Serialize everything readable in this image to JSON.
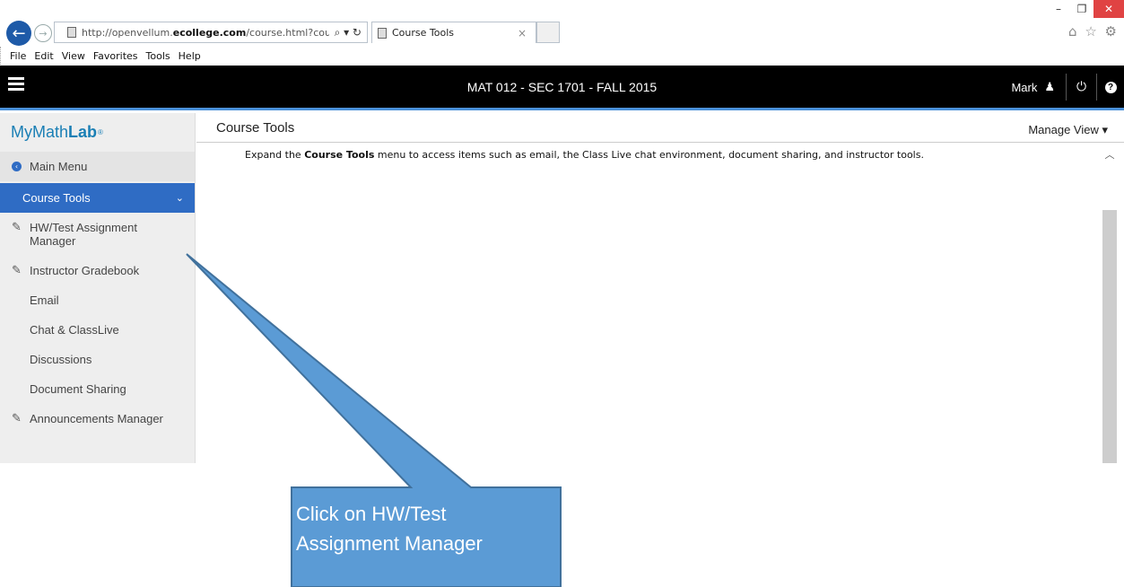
{
  "browser": {
    "window_controls": {
      "minimize": "–",
      "restore": "❐",
      "close": "✕"
    },
    "url_prefix": "http://openvellum.",
    "url_domain": "ecollege.com",
    "url_path": "/course.html?coursel",
    "address_tools": "⌕ ▾ ↻",
    "tab_title": "Course Tools",
    "tab_close": "×",
    "fav_icons": "⌂ ☆ ⚙",
    "menu": [
      "File",
      "Edit",
      "View",
      "Favorites",
      "Tools",
      "Help"
    ]
  },
  "header": {
    "course_title": "MAT 012 - SEC 1701 - FALL 2015",
    "user_name": "Mark",
    "help": "?"
  },
  "sidebar": {
    "brand_my": "My",
    "brand_math": "Math",
    "brand_lab": "Lab",
    "brand_reg": "®",
    "main_menu": "Main Menu",
    "active": "Course Tools",
    "items": [
      {
        "label": "HW/Test Assignment Manager",
        "icon": "tool-icon"
      },
      {
        "label": "Instructor Gradebook",
        "icon": "tool-icon"
      },
      {
        "label": "Email"
      },
      {
        "label": "Chat & ClassLive"
      },
      {
        "label": "Discussions"
      },
      {
        "label": "Document Sharing"
      },
      {
        "label": "Announcements Manager",
        "icon": "tool-icon"
      }
    ]
  },
  "content": {
    "title": "Course Tools",
    "manage_view": "Manage View ▾",
    "intro_before": "Expand the ",
    "intro_bold": "Course Tools",
    "intro_after": " menu to access items such as email, the Class Live chat environment, document sharing, and instructor tools."
  },
  "callout": {
    "line1": "Click on HW/Test",
    "line2": "Assignment Manager",
    "fill_color": "#5b9bd5",
    "border_color": "#41719c"
  }
}
